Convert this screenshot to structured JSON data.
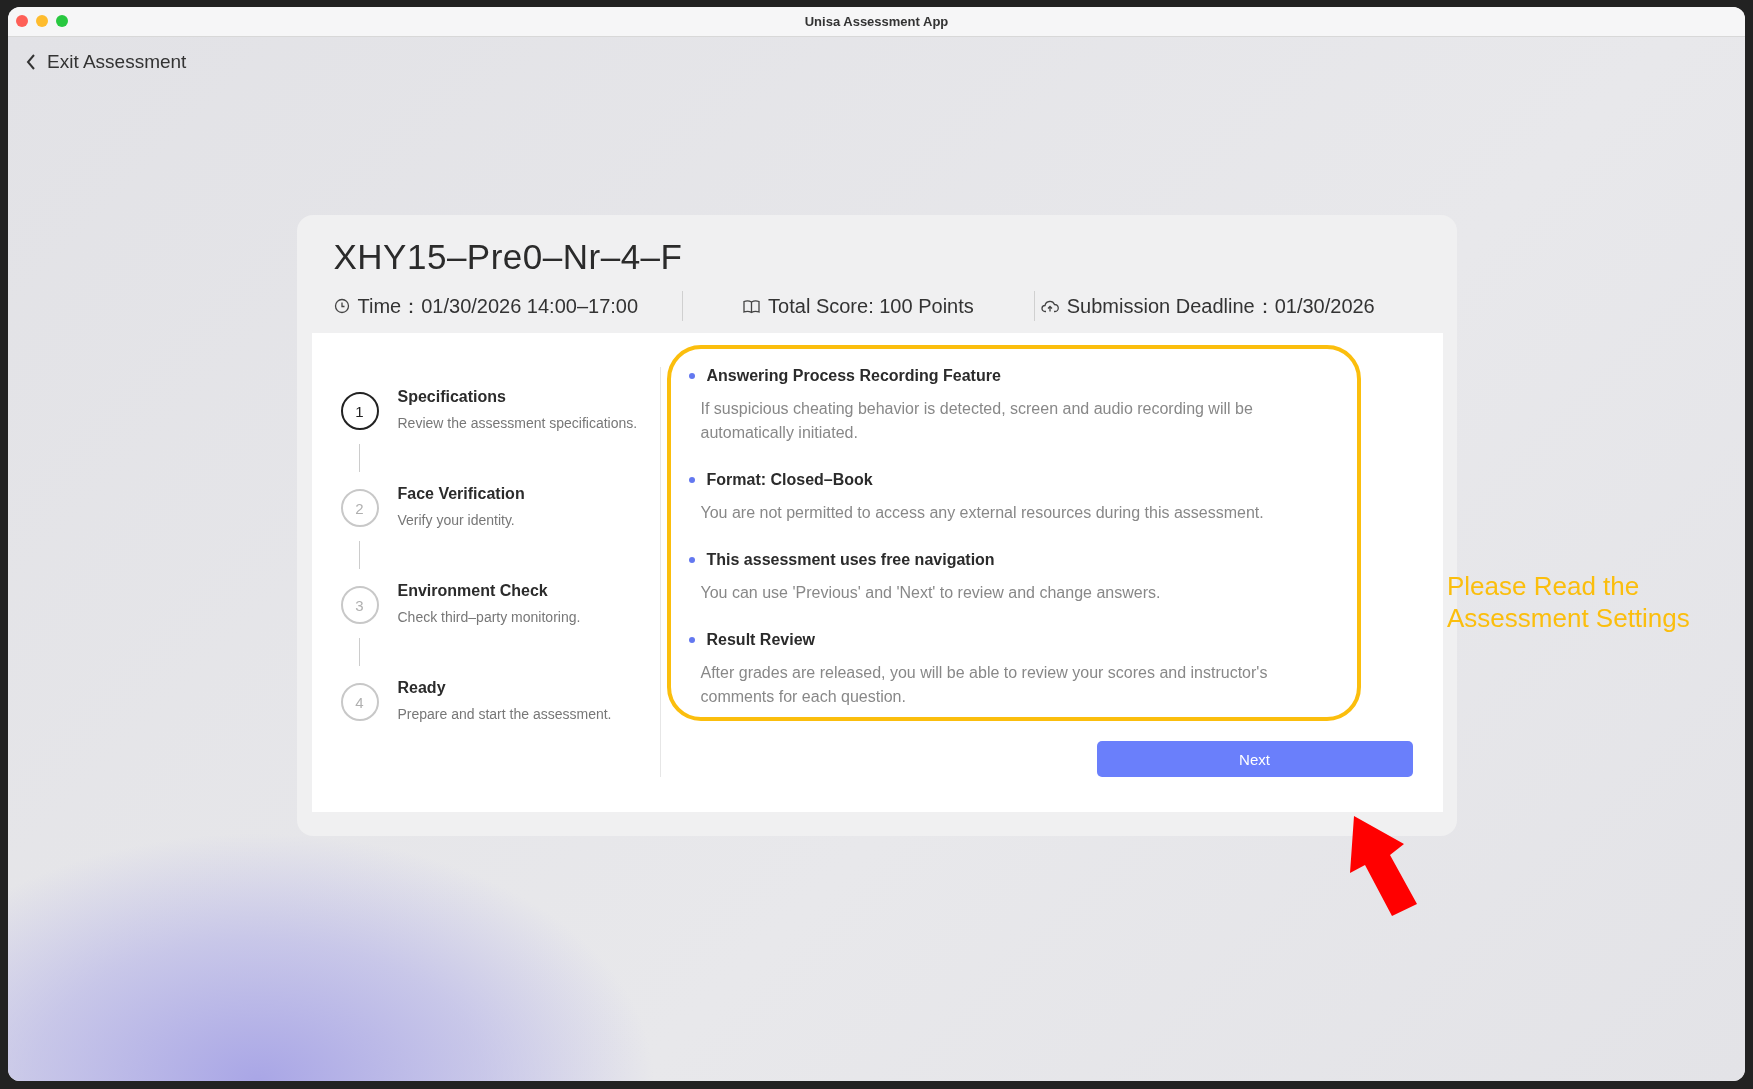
{
  "window": {
    "title": "Unisa Assessment App"
  },
  "back_link": {
    "label": "Exit Assessment"
  },
  "assessment": {
    "title": "XHY15–Pre0–Nr–4–F",
    "time": "Time：01/30/2026 14:00–17:00",
    "total_score": "Total Score: 100 Points",
    "deadline": "Submission Deadline：01/30/2026"
  },
  "steps": [
    {
      "number": "1",
      "title": "Specifications",
      "description": "Review the assessment specifications.",
      "selected": true
    },
    {
      "number": "2",
      "title": "Face Verification",
      "description": "Verify your identity.",
      "selected": false
    },
    {
      "number": "3",
      "title": "Environment Check",
      "description": "Check third–party monitoring.",
      "selected": false
    },
    {
      "number": "4",
      "title": "Ready",
      "description": "Prepare and start the assessment.",
      "selected": false
    }
  ],
  "settings": [
    {
      "title": "Answering Process Recording Feature",
      "description": "If suspicious cheating behavior is detected, screen and audio recording will be automatically initiated."
    },
    {
      "title": "Format: Closed–Book",
      "description": "You are not permitted to access any external resources during this assessment."
    },
    {
      "title": "This assessment uses free navigation",
      "description": "You can use 'Previous' and 'Next' to review and change answers."
    },
    {
      "title": "Result Review",
      "description": "After grades are released, you will be able to review your scores and instructor's comments for each question."
    }
  ],
  "next_button": {
    "label": "Next"
  },
  "annotation": {
    "text": "Please Read the Assessment Settings"
  }
}
